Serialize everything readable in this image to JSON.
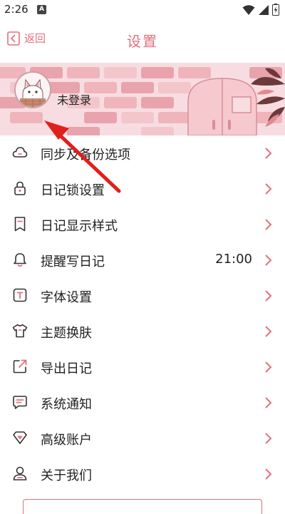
{
  "status_bar": {
    "time": "2:26",
    "notif_badge": "A"
  },
  "header": {
    "back_label": "返回",
    "title": "设置"
  },
  "profile": {
    "login_status": "未登录"
  },
  "colors": {
    "accent": "#e2707f",
    "arrow": "#e0201c",
    "banner_bg": "#f7dde1"
  },
  "settings": [
    {
      "icon": "cloud-icon",
      "label": "同步及备份选项",
      "value": ""
    },
    {
      "icon": "lock-icon",
      "label": "日记锁设置",
      "value": ""
    },
    {
      "icon": "bookmark-icon",
      "label": "日记显示样式",
      "value": ""
    },
    {
      "icon": "bell-icon",
      "label": "提醒写日记",
      "value": "21:00"
    },
    {
      "icon": "font-icon",
      "label": "字体设置",
      "value": ""
    },
    {
      "icon": "tshirt-icon",
      "label": "主题换肤",
      "value": ""
    },
    {
      "icon": "export-icon",
      "label": "导出日记",
      "value": ""
    },
    {
      "icon": "message-icon",
      "label": "系统通知",
      "value": ""
    },
    {
      "icon": "gem-icon",
      "label": "高级账户",
      "value": ""
    },
    {
      "icon": "person-icon",
      "label": "关于我们",
      "value": ""
    }
  ]
}
